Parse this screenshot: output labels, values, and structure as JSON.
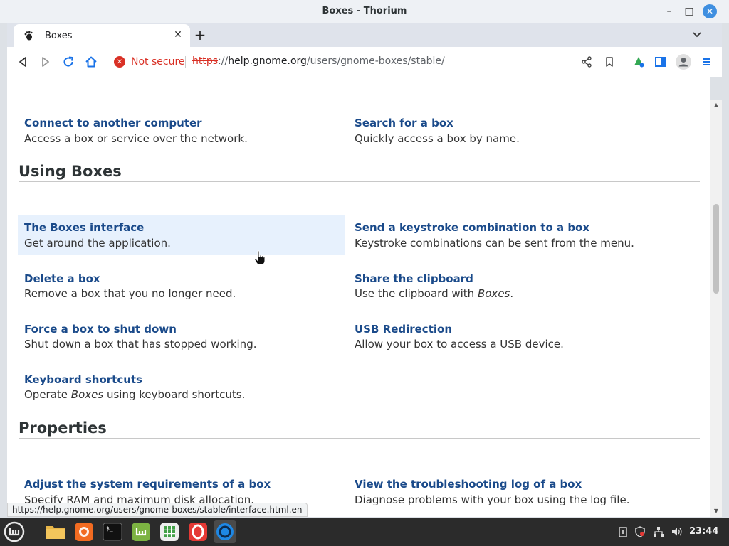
{
  "window": {
    "title": "Boxes - Thorium",
    "minimize_glyph": "–",
    "maximize_glyph": "□",
    "close_glyph": "✕"
  },
  "tab": {
    "title": "Boxes",
    "close_glyph": "✕",
    "new_tab_glyph": "+",
    "menu_glyph": "⌄"
  },
  "addressbar": {
    "security_label": "Not secure",
    "security_glyph": "✕",
    "url_scheme": "https",
    "url_sep": "://",
    "url_host": "help.gnome.org",
    "url_path": "/users/gnome-boxes/stable/"
  },
  "page": {
    "top_items": [
      {
        "title": "Connect to another computer",
        "desc": "Access a box or service over the network."
      },
      {
        "title": "Search for a box",
        "desc": "Quickly access a box by name."
      }
    ],
    "sections": [
      {
        "heading": "Using Boxes",
        "items": [
          {
            "title": "The Boxes interface",
            "desc": "Get around the application."
          },
          {
            "title": "Send a keystroke combination to a box",
            "desc": "Keystroke combinations can be sent from the menu."
          },
          {
            "title": "Delete a box",
            "desc": "Remove a box that you no longer need."
          },
          {
            "title": "Share the clipboard",
            "desc_pre": "Use the clipboard with ",
            "desc_em": "Boxes",
            "desc_post": "."
          },
          {
            "title": "Force a box to shut down",
            "desc": "Shut down a box that has stopped working."
          },
          {
            "title": "USB Redirection",
            "desc": "Allow your box to access a USB device."
          },
          {
            "title": "Keyboard shortcuts",
            "desc_pre": "Operate ",
            "desc_em": "Boxes",
            "desc_post": " using keyboard shortcuts."
          }
        ]
      },
      {
        "heading": "Properties",
        "items": [
          {
            "title": "Adjust the system requirements of a box",
            "desc": "Specify RAM and maximum disk allocation."
          },
          {
            "title": "View the troubleshooting log of a box",
            "desc": "Diagnose problems with your box using the log file."
          }
        ]
      }
    ]
  },
  "status_url": "https://help.gnome.org/users/gnome-boxes/stable/interface.html.en",
  "taskbar": {
    "clock": "23:44",
    "apps": [
      "mint-menu",
      "files",
      "firefox",
      "terminal",
      "mintinstall",
      "spreadsheet",
      "opera",
      "thorium"
    ]
  },
  "colors": {
    "link": "#1a4a8a",
    "hover_bg": "#e7f1fd",
    "not_secure": "#d93025",
    "close_button": "#3f8fe0"
  }
}
